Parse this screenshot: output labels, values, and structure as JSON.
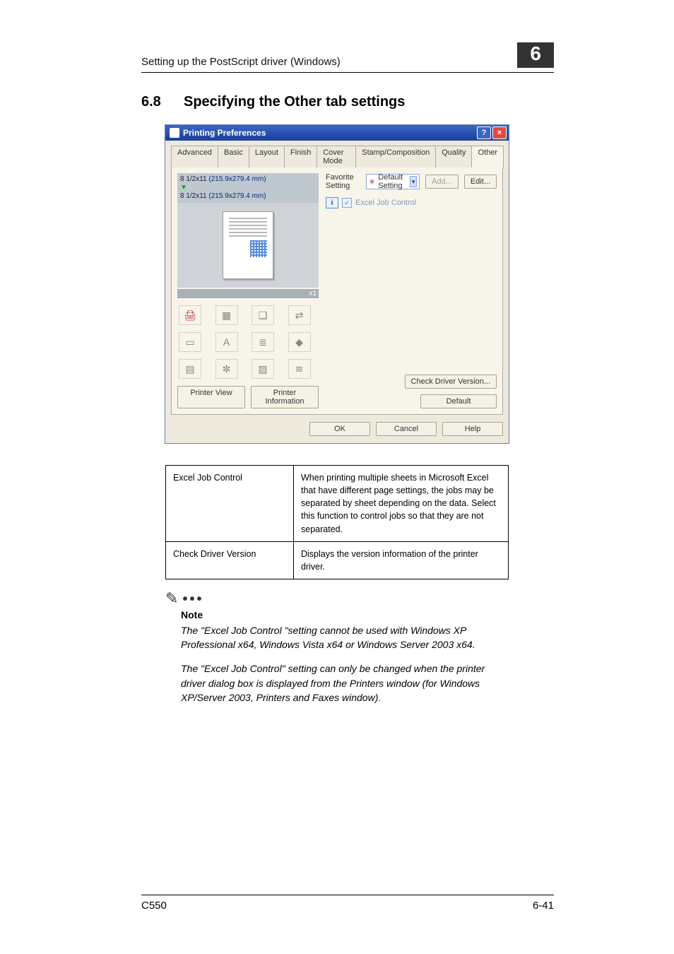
{
  "header": {
    "text": "Setting up the PostScript driver (Windows)",
    "chapter": "6"
  },
  "section": {
    "number": "6.8",
    "title": "Specifying the Other tab settings"
  },
  "dialog": {
    "title": "Printing Preferences",
    "help_btn": "?",
    "close_btn": "×",
    "tabs": [
      "Advanced",
      "Basic",
      "Layout",
      "Finish",
      "Cover Mode",
      "Stamp/Composition",
      "Quality",
      "Other"
    ],
    "active_tab": "Other",
    "preview": {
      "line1a": "8 1/2x11 ",
      "line1b": "(215.9x279.4 mm)",
      "line2a": "8 1/2x11 ",
      "line2b": "(215.9x279.4 mm)",
      "zoom": "x1"
    },
    "printer_view_btn": "Printer View",
    "printer_info_btn": "Printer Information",
    "favorite_label": "Favorite Setting",
    "favorite_value": "Default Setting",
    "add_btn": "Add...",
    "edit_btn": "Edit...",
    "excel_job_label": "Excel Job Control",
    "check_driver_btn": "Check Driver Version...",
    "default_btn": "Default",
    "ok_btn": "OK",
    "cancel_btn": "Cancel",
    "helpb_btn": "Help"
  },
  "table": {
    "r1c1": "Excel Job Control",
    "r1c2": "When printing multiple sheets in Microsoft Excel that have different page settings, the jobs may be separated by sheet depending on the data. Select this function to control jobs so that they are not separated.",
    "r2c1": "Check Driver Version",
    "r2c2": "Displays the version information of the printer driver."
  },
  "note": {
    "label": "Note",
    "p1": "The \"Excel Job Control \"setting cannot be used with Windows XP Professional x64, Windows Vista x64 or Windows Server 2003 x64.",
    "p2": "The \"Excel Job Control\" setting can only be changed when the printer driver dialog box is displayed from the Printers window (for Windows XP/Server 2003, Printers and Faxes window)."
  },
  "footer": {
    "left": "C550",
    "right": "6-41"
  }
}
